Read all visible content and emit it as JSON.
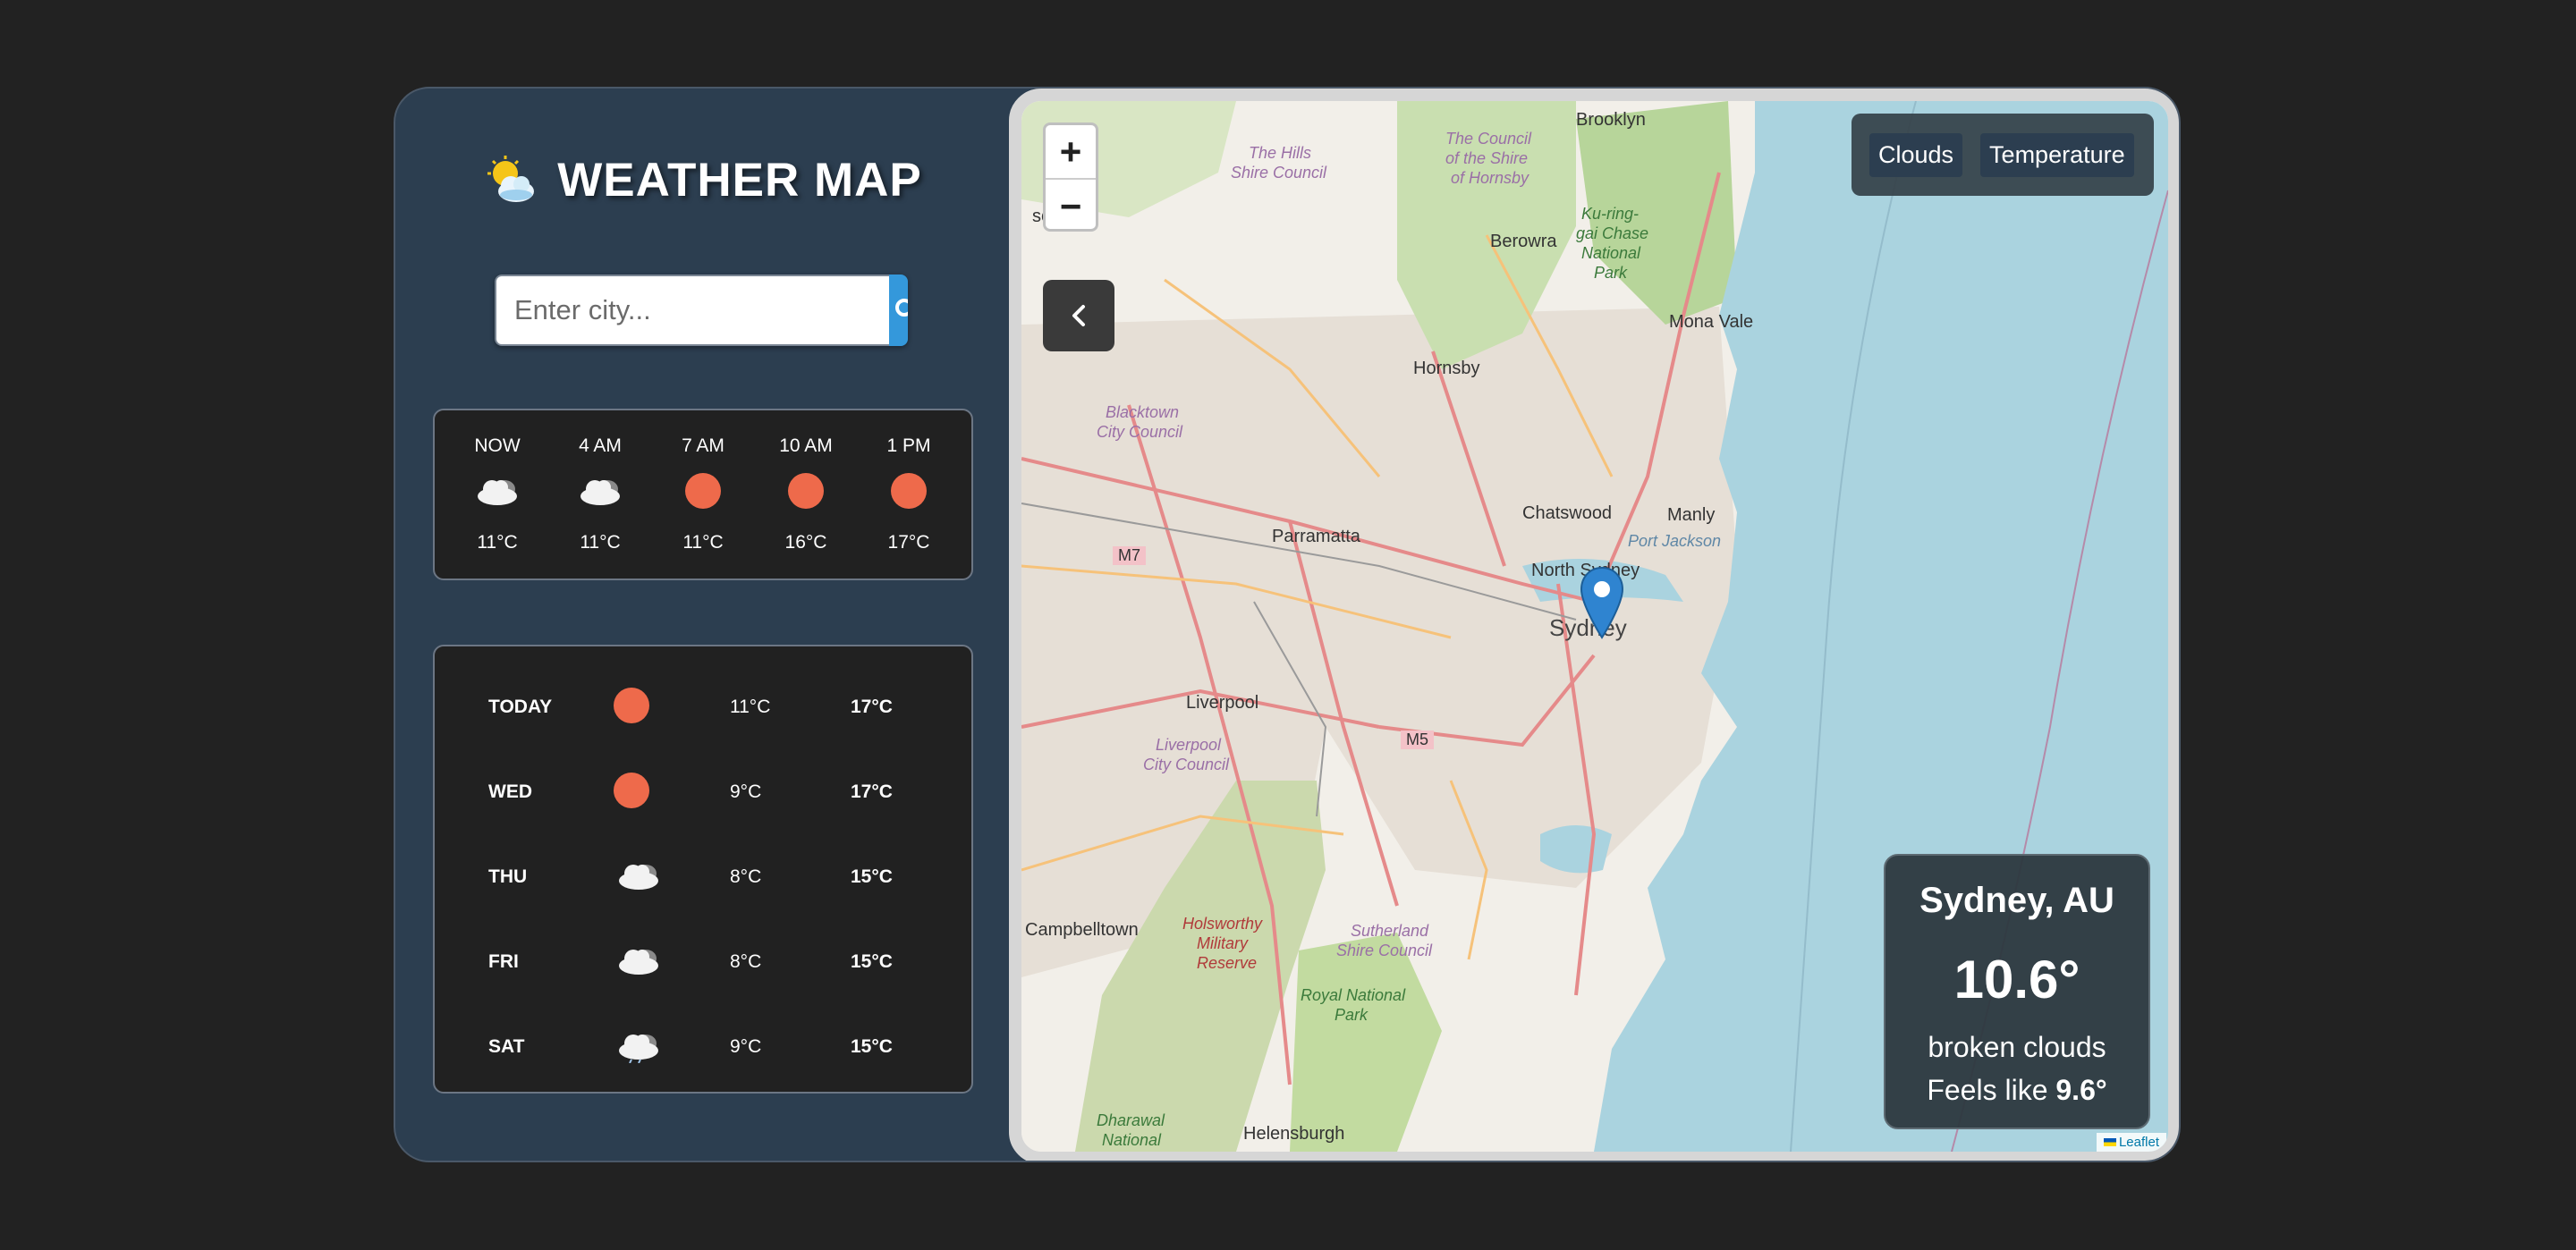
{
  "header": {
    "title": "WEATHER MAP",
    "logo_icon": "sun-cloud-icon"
  },
  "search": {
    "placeholder": "Enter city...",
    "button_icon": "search-icon"
  },
  "hourly": [
    {
      "label": "NOW",
      "icon": "cloud-icon",
      "temp": "11°C"
    },
    {
      "label": "4 AM",
      "icon": "cloud-icon",
      "temp": "11°C"
    },
    {
      "label": "7 AM",
      "icon": "sun-icon",
      "temp": "11°C"
    },
    {
      "label": "10 AM",
      "icon": "sun-icon",
      "temp": "16°C"
    },
    {
      "label": "1 PM",
      "icon": "sun-icon",
      "temp": "17°C"
    }
  ],
  "daily": [
    {
      "day": "TODAY",
      "icon": "sun-icon",
      "min": "11°C",
      "max": "17°C"
    },
    {
      "day": "WED",
      "icon": "sun-icon",
      "min": "9°C",
      "max": "17°C"
    },
    {
      "day": "THU",
      "icon": "cloud-icon",
      "min": "8°C",
      "max": "15°C"
    },
    {
      "day": "FRI",
      "icon": "cloud-icon",
      "min": "8°C",
      "max": "15°C"
    },
    {
      "day": "SAT",
      "icon": "rain-cloud-icon",
      "min": "9°C",
      "max": "15°C"
    }
  ],
  "map": {
    "zoom_in": "+",
    "zoom_out": "−",
    "layers": [
      "Clouds",
      "Temperature"
    ],
    "attribution": "Leaflet",
    "labels": {
      "brooklyn": "Brooklyn",
      "hills": "The Hills",
      "hills2": "Shire Council",
      "hornsby_council": "The Council",
      "hornsby_council2": "of the Shire",
      "hornsby_council3": "of Hornsby",
      "berowra": "Berowra",
      "kuring": "Ku-ring-",
      "kuring2": "gai Chase",
      "kuring3": "National",
      "kuring4": "Park",
      "mona_vale": "Mona Vale",
      "hornsby": "Hornsby",
      "blacktown": "Blacktown",
      "blacktown2": "City Council",
      "chatswood": "Chatswood",
      "manly": "Manly",
      "port_jackson": "Port Jackson",
      "parramatta": "Parramatta",
      "m7": "M7",
      "north_sydney": "North Sydney",
      "sydney": "Sydney",
      "liverpool": "Liverpool",
      "liverpool_cc": "Liverpool",
      "liverpool_cc2": "City Council",
      "m5": "M5",
      "campbelltown": "Campbelltown",
      "holsworthy": "Holsworthy",
      "holsworthy2": "Military",
      "holsworthy3": "Reserve",
      "sutherland": "Sutherland",
      "sutherland2": "Shire Council",
      "royal": "Royal National",
      "royal2": "Park",
      "dharawal": "Dharawal",
      "dharawal2": "National",
      "helensburgh": "Helensburgh",
      "windsor": "sor"
    }
  },
  "current": {
    "city": "Sydney, AU",
    "temp": "10.6°",
    "description": "broken clouds",
    "feels_like_label": "Feels like ",
    "feels_like_value": "9.6°"
  },
  "colors": {
    "accent": "#3498db",
    "panel": "#2c3e50",
    "sun": "#ee6a4b",
    "water": "#aad3df"
  }
}
